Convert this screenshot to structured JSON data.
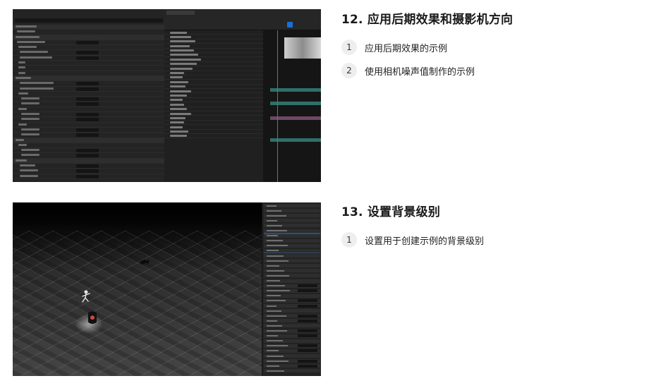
{
  "sections": [
    {
      "title": "12. 应用后期效果和摄影机方向",
      "steps": [
        {
          "num": "1",
          "text": "应用后期效果的示例"
        },
        {
          "num": "2",
          "text": "使用相机噪声值制作的示例"
        }
      ]
    },
    {
      "title": "13. 设置背景级别",
      "steps": [
        {
          "num": "1",
          "text": "设置用于创建示例的背景级别"
        }
      ]
    }
  ],
  "colors": {
    "accent_blue": "#1b6fd6",
    "playhead": "#d84a2b",
    "step_circle": "#eeeeee"
  }
}
